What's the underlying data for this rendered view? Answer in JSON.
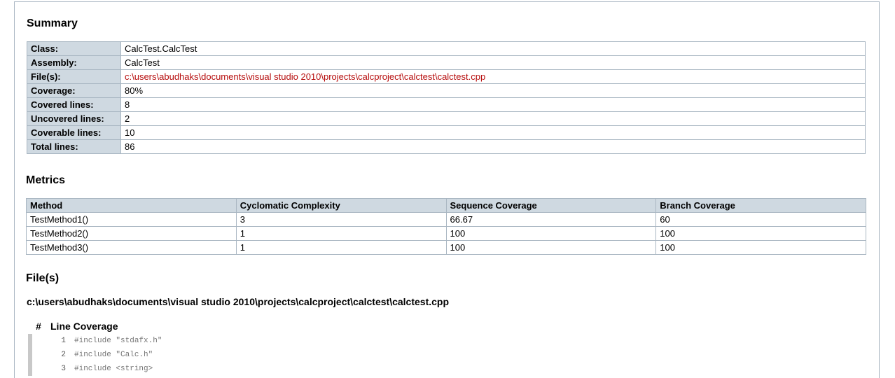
{
  "summary": {
    "heading": "Summary",
    "rows": [
      {
        "label": "Class:",
        "value": "CalcTest.CalcTest"
      },
      {
        "label": "Assembly:",
        "value": "CalcTest"
      },
      {
        "label": "File(s):",
        "value": "c:\\users\\abudhaks\\documents\\visual studio 2010\\projects\\calcproject\\calctest\\calctest.cpp"
      },
      {
        "label": "Coverage:",
        "value": "80%"
      },
      {
        "label": "Covered lines:",
        "value": "8"
      },
      {
        "label": "Uncovered lines:",
        "value": "2"
      },
      {
        "label": "Coverable lines:",
        "value": "10"
      },
      {
        "label": "Total lines:",
        "value": "86"
      }
    ]
  },
  "metrics": {
    "heading": "Metrics",
    "columns": [
      "Method",
      "Cyclomatic Complexity",
      "Sequence Coverage",
      "Branch Coverage"
    ],
    "rows": [
      [
        "TestMethod1()",
        "3",
        "66.67",
        "60"
      ],
      [
        "TestMethod2()",
        "1",
        "100",
        "100"
      ],
      [
        "TestMethod3()",
        "1",
        "100",
        "100"
      ]
    ]
  },
  "files": {
    "heading": "File(s)",
    "path": "c:\\users\\abudhaks\\documents\\visual studio 2010\\projects\\calcproject\\calctest\\calctest.cpp",
    "col_hash": "#",
    "col_line_coverage": "Line Coverage",
    "lines": [
      {
        "num": "1",
        "src": "#include \"stdafx.h\""
      },
      {
        "num": "2",
        "src": "#include \"Calc.h\""
      },
      {
        "num": "3",
        "src": "#include <string>"
      }
    ]
  }
}
